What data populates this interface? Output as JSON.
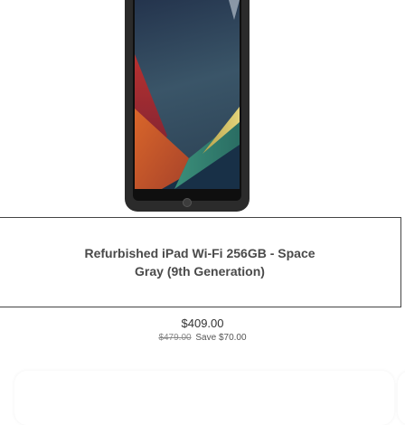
{
  "product": {
    "image_alt": "Refurbished iPad Wi-Fi 256GB - Space Gray (9th Generation)",
    "title": "Refurbished iPad Wi-Fi 256GB - Space Gray (9th Generation)",
    "price": "$409.00",
    "original_price": "$479.00",
    "savings": "Save $70.00"
  }
}
